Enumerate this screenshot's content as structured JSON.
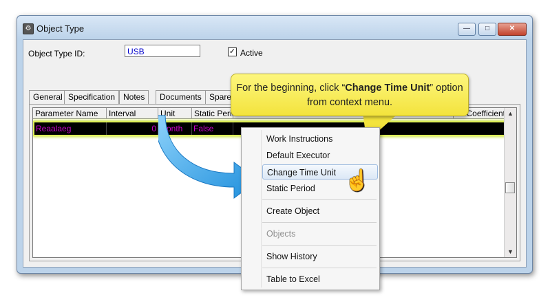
{
  "window": {
    "title": "Object Type",
    "minimize": "—",
    "maximize": "□",
    "close": "✕"
  },
  "form": {
    "object_type_id_label": "Object Type ID:",
    "object_type_id_value": "USB",
    "active_label": "Active",
    "active_checked": "✓"
  },
  "tabs": [
    "General",
    "Specification",
    "Notes",
    "Documents",
    "Spare"
  ],
  "grid": {
    "headers": [
      "Parameter Name",
      "Interval",
      "Unit",
      "Static Period",
      "Coefficient"
    ],
    "row": {
      "parameter_name": "Reaalaeg",
      "interval": "0",
      "unit": "Month",
      "static_period": "False"
    }
  },
  "context_menu": {
    "items": [
      "Work Instructions",
      "Default Executor",
      "Change Time Unit",
      "Static Period",
      "Create Object",
      "Objects",
      "Show History",
      "Table to Excel"
    ]
  },
  "callout": {
    "before": "For the beginning, click “",
    "bold": "Change Time Unit",
    "after": "” option from context menu."
  },
  "icons": {
    "cursor": "hand-pointer-icon",
    "arrow": "curved-arrow-icon"
  },
  "colors": {
    "highlight_row": "#000000",
    "row_text": "#cc00cc",
    "callout": "#f3e33c",
    "arrow": "#3aa6e6"
  }
}
